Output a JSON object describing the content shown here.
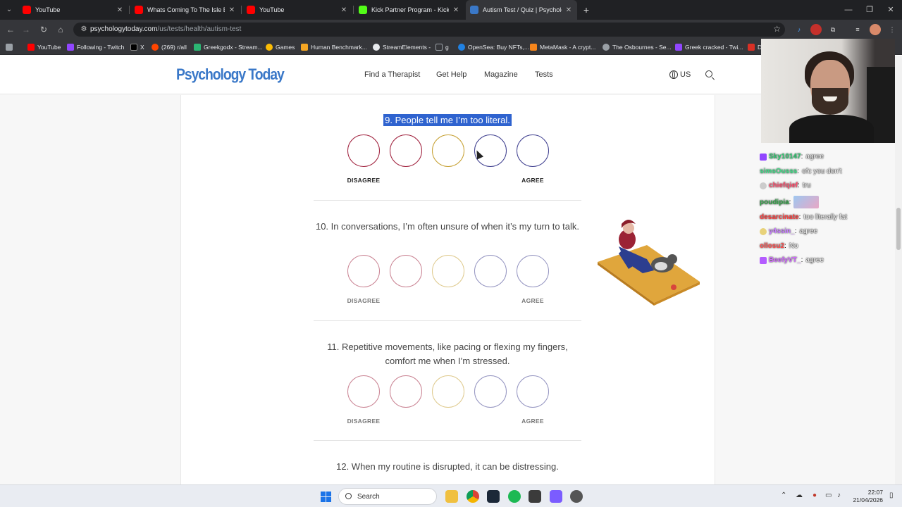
{
  "browser": {
    "tabs": [
      {
        "title": "YouTube",
        "favicon_color": "#ff0000"
      },
      {
        "title": "Whats Coming To The Isle Evrim",
        "favicon_color": "#ff0000"
      },
      {
        "title": "YouTube",
        "favicon_color": "#ff0000"
      },
      {
        "title": "Kick Partner Program - Kick Das",
        "favicon_color": "#53fc18"
      },
      {
        "title": "Autism Test / Quiz | Psychology",
        "favicon_color": "#3a78c8"
      }
    ],
    "url_domain": "psychologytoday.com",
    "url_path": "/us/tests/health/autism-test",
    "bookmarks": [
      {
        "label": "YouTube",
        "color": "#ff0000"
      },
      {
        "label": "Following - Twitch",
        "color": "#9146ff"
      },
      {
        "label": "X",
        "color": "#000000"
      },
      {
        "label": "(269) r/all",
        "color": "#ff4500"
      },
      {
        "label": "Greekgodx - Stream...",
        "color": "#2bb673"
      },
      {
        "label": "Games",
        "color": "#fbbc05"
      },
      {
        "label": "Human Benchmark...",
        "color": "#f5a623"
      },
      {
        "label": "StreamElements -",
        "color": "#e8eaed"
      },
      {
        "label": "g",
        "color": "#9aa0a6"
      },
      {
        "label": "OpenSea: Buy NFTs,...",
        "color": "#2081e2"
      },
      {
        "label": "MetaMask - A crypt...",
        "color": "#f6851b"
      },
      {
        "label": "The Osbournes - Se...",
        "color": "#9aa0a6"
      },
      {
        "label": "Greek cracked - Twi...",
        "color": "#9146ff"
      },
      {
        "label": "D",
        "color": "#d93025"
      }
    ]
  },
  "site": {
    "logo": "Psychology Today",
    "nav": [
      "Find a Therapist",
      "Get Help",
      "Magazine",
      "Tests"
    ],
    "region": "US"
  },
  "quiz": {
    "questions": [
      {
        "text": "9. People tell me I’m too literal."
      },
      {
        "text": "10. In conversations, I’m often unsure of when it’s my turn to talk."
      },
      {
        "text": "11. Repetitive movements, like pacing or flexing my fingers, comfort me when I’m stressed."
      },
      {
        "text": "12. When my routine is disrupted, it can be distressing."
      }
    ],
    "disagree_label": "DISAGREE",
    "agree_label": "AGREE",
    "choice_colors": [
      "#a0213d",
      "#a0213d",
      "#c6a032",
      "#3f3f8f",
      "#3f3f8f"
    ]
  },
  "stream_chat": [
    {
      "user": "Sky10147",
      "color": "#2ecc71",
      "message": "agree",
      "badge": "#9146ff"
    },
    {
      "user": "simsOusss",
      "color": "#3ddc84",
      "message": "ofc you don't",
      "badge": ""
    },
    {
      "user": "chiefqief",
      "color": "#ff4d6d",
      "message": "tru",
      "badge": "#cccccc"
    },
    {
      "user": "poudipia",
      "color": "#2ea043",
      "message": "",
      "badge": ""
    },
    {
      "user": "desarcinate",
      "color": "#ff3b3b",
      "message": "too literally fat",
      "badge": ""
    },
    {
      "user": "y4ssin_",
      "color": "#c77dff",
      "message": "agree",
      "badge": "#e8d27a"
    },
    {
      "user": "ollosu2",
      "color": "#ff4d4d",
      "message": "No",
      "badge": ""
    },
    {
      "user": "BeefyVT_",
      "color": "#d16bff",
      "message": "agree",
      "badge": "#b45cff"
    }
  ],
  "taskbar": {
    "search_label": "Search",
    "time": "22:07",
    "date": "21/04/2026"
  }
}
